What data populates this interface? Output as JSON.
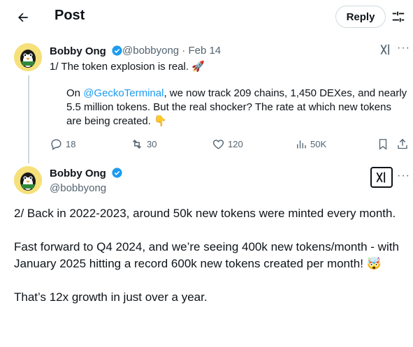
{
  "header": {
    "title": "Post",
    "reply_label": "Reply"
  },
  "icons": {
    "back": "arrow-left-icon",
    "filter": "sliders-icon",
    "verified": "verified-badge-icon",
    "grok": "grok-icon",
    "more": "more-dots-icon",
    "reply": "reply-icon",
    "repost": "repost-icon",
    "like": "heart-icon",
    "views": "bar-chart-icon",
    "bookmark": "bookmark-icon",
    "share": "share-icon"
  },
  "colors": {
    "accent": "#1d9bf0",
    "verified": "#1d9bf0",
    "muted": "#536471"
  },
  "tweet1": {
    "name": "Bobby Ong",
    "handle_meta": "@bobbyong · Feb 14",
    "line1": "1/ The token explosion is real. 🚀",
    "body_pre": "On ",
    "mention": "@GeckoTerminal",
    "body_post": ", we now track 209 chains, 1,450 DEXes, and nearly 5.5 million tokens. But the real shocker? The rate at which new tokens are being created. 👇",
    "more": "···",
    "stats": {
      "replies": "18",
      "reposts": "30",
      "likes": "120",
      "views": "50K"
    }
  },
  "tweet2": {
    "name": "Bobby Ong",
    "handle": "@bobbyong",
    "more": "···",
    "paragraphs": [
      "2/ Back in 2022-2023, around 50k new tokens were minted every month.",
      "Fast forward to Q4 2024, and we’re seeing 400k new tokens/month - with January 2025 hitting a record 600k new tokens created per month! 🤯",
      "That’s 12x growth in just over a year."
    ]
  }
}
